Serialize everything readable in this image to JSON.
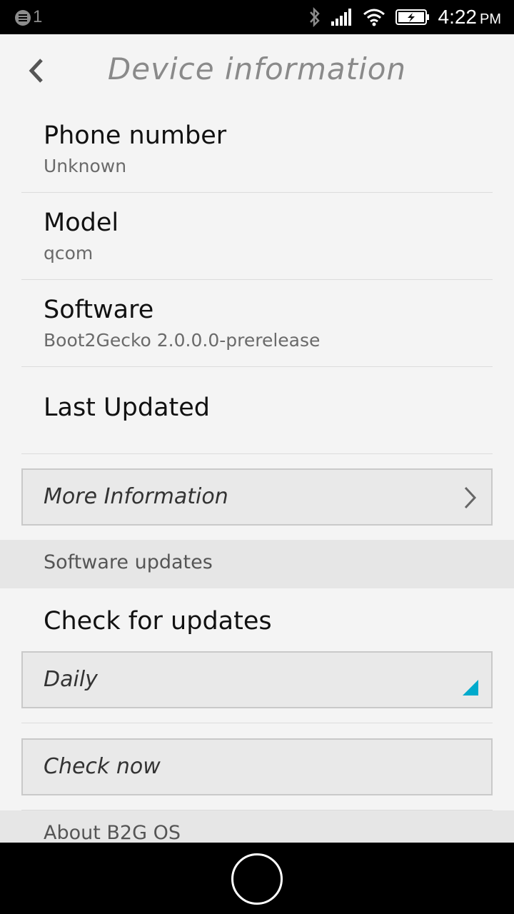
{
  "status_bar": {
    "notification_count": "1",
    "time": "4:22",
    "ampm": "PM",
    "icons": [
      "notification-icon",
      "bluetooth-icon",
      "signal-icon",
      "wifi-icon",
      "battery-charging-icon"
    ]
  },
  "header": {
    "title": "Device information",
    "back_icon": "chevron-left-icon"
  },
  "info": {
    "phone_number": {
      "label": "Phone number",
      "value": "Unknown"
    },
    "model": {
      "label": "Model",
      "value": "qcom"
    },
    "software": {
      "label": "Software",
      "value": "Boot2Gecko 2.0.0.0-prerelease"
    },
    "last_updated": {
      "label": "Last Updated",
      "value": ""
    }
  },
  "more_info_button": {
    "label": "More Information",
    "icon": "chevron-right-icon"
  },
  "software_updates": {
    "section_label": "Software updates",
    "check_label": "Check for updates",
    "frequency_select": {
      "value": "Daily",
      "accent_color": "#00aacc"
    },
    "check_now_label": "Check now"
  },
  "about": {
    "section_label": "About B2G OS"
  },
  "navbar": {
    "home_icon": "home-icon"
  }
}
